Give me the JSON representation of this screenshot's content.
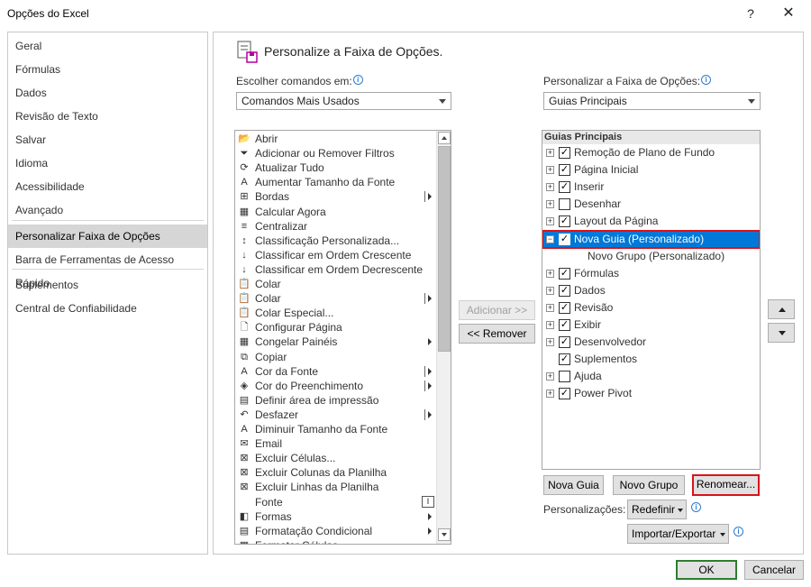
{
  "window": {
    "title": "Opções do Excel",
    "help_glyph": "?",
    "close_glyph": "✕"
  },
  "nav": {
    "items": [
      {
        "label": "Geral"
      },
      {
        "label": "Fórmulas"
      },
      {
        "label": "Dados"
      },
      {
        "label": "Revisão de Texto"
      },
      {
        "label": "Salvar"
      },
      {
        "label": "Idioma"
      },
      {
        "label": "Acessibilidade"
      },
      {
        "label": "Avançado"
      },
      {
        "label": "Personalizar Faixa de Opções",
        "active": true
      },
      {
        "label": "Barra de Ferramentas de Acesso Rápido"
      },
      {
        "label": "Suplementos"
      },
      {
        "label": "Central de Confiabilidade"
      }
    ]
  },
  "main": {
    "heading": "Personalize a Faixa de Opções.",
    "choose_label": "Escolher comandos em:",
    "choose_value": "Comandos Mais Usados",
    "customize_label": "Personalizar a Faixa de Opções:",
    "customize_value": "Guias Principais"
  },
  "commands": [
    {
      "icon": "folder-open-icon",
      "glyph": "📂",
      "label": "Abrir"
    },
    {
      "icon": "filter-icon",
      "glyph": "⏷",
      "label": "Adicionar ou Remover Filtros"
    },
    {
      "icon": "refresh-icon",
      "glyph": "⟳",
      "label": "Atualizar Tudo"
    },
    {
      "icon": "font-grow-icon",
      "glyph": "A",
      "label": "Aumentar Tamanho da Fonte"
    },
    {
      "icon": "borders-icon",
      "glyph": "⊞",
      "label": "Bordas",
      "submenu": "bar"
    },
    {
      "icon": "calculator-icon",
      "glyph": "▦",
      "label": "Calcular Agora"
    },
    {
      "icon": "center-align-icon",
      "glyph": "≡",
      "label": "Centralizar"
    },
    {
      "icon": "custom-sort-icon",
      "glyph": "↕",
      "label": "Classificação Personalizada..."
    },
    {
      "icon": "sort-asc-icon",
      "glyph": "↓",
      "label": "Classificar em Ordem Crescente"
    },
    {
      "icon": "sort-desc-icon",
      "glyph": "↓",
      "label": "Classificar em Ordem Decrescente"
    },
    {
      "icon": "paste-icon",
      "glyph": "📋",
      "label": "Colar"
    },
    {
      "icon": "paste-menu-icon",
      "glyph": "📋",
      "label": "Colar",
      "submenu": "bar"
    },
    {
      "icon": "paste-special-icon",
      "glyph": "📋",
      "label": "Colar Especial..."
    },
    {
      "icon": "page-setup-icon",
      "glyph": "🗋",
      "label": "Configurar Página"
    },
    {
      "icon": "freeze-panes-icon",
      "glyph": "▦",
      "label": "Congelar Painéis",
      "submenu": "arrow"
    },
    {
      "icon": "copy-icon",
      "glyph": "⧉",
      "label": "Copiar"
    },
    {
      "icon": "font-color-icon",
      "glyph": "A",
      "label": "Cor da Fonte",
      "submenu": "bar"
    },
    {
      "icon": "fill-color-icon",
      "glyph": "◈",
      "label": "Cor do Preenchimento",
      "submenu": "bar"
    },
    {
      "icon": "print-area-icon",
      "glyph": "▤",
      "label": "Definir área de impressão"
    },
    {
      "icon": "undo-icon",
      "glyph": "↶",
      "label": "Desfazer",
      "submenu": "bar"
    },
    {
      "icon": "font-shrink-icon",
      "glyph": "A",
      "label": "Diminuir Tamanho da Fonte"
    },
    {
      "icon": "email-icon",
      "glyph": "✉",
      "label": "Email"
    },
    {
      "icon": "delete-cells-icon",
      "glyph": "⊠",
      "label": "Excluir Células..."
    },
    {
      "icon": "delete-columns-icon",
      "glyph": "⊠",
      "label": "Excluir Colunas da Planilha"
    },
    {
      "icon": "delete-rows-icon",
      "glyph": "⊠",
      "label": "Excluir Linhas da Planilha"
    },
    {
      "icon": "font-icon",
      "glyph": "",
      "label": "Fonte",
      "submenu": "fontbox"
    },
    {
      "icon": "shapes-icon",
      "glyph": "◧",
      "label": "Formas",
      "submenu": "arrow"
    },
    {
      "icon": "conditional-format-icon",
      "glyph": "▤",
      "label": "Formatação Condicional",
      "submenu": "arrow"
    },
    {
      "icon": "format-cells-icon",
      "glyph": "▦",
      "label": "Formatar Células..."
    }
  ],
  "font_box_glyph": "I",
  "buttons": {
    "add": "Adicionar >>",
    "remove": "<< Remover",
    "new_tab": "Nova Guia",
    "new_group": "Novo Grupo",
    "rename": "Renomear...",
    "customizations_label": "Personalizações:",
    "reset": "Redefinir",
    "import_export": "Importar/Exportar",
    "ok": "OK",
    "cancel": "Cancelar"
  },
  "tree": {
    "header": "Guias Principais",
    "nodes": [
      {
        "label": "Remoção de Plano de Fundo",
        "checked": true,
        "expand": "⊞"
      },
      {
        "label": "Página Inicial",
        "checked": true,
        "expand": "⊞"
      },
      {
        "label": "Inserir",
        "checked": true,
        "expand": "⊞"
      },
      {
        "label": "Desenhar",
        "checked": false,
        "expand": "⊞"
      },
      {
        "label": "Layout da Página",
        "checked": true,
        "expand": "⊞"
      },
      {
        "label": "Nova Guia (Personalizado)",
        "checked": true,
        "expand": "⊟",
        "selected": true
      },
      {
        "label": "Novo Grupo (Personalizado)",
        "child": true
      },
      {
        "label": "Fórmulas",
        "checked": true,
        "expand": "⊞"
      },
      {
        "label": "Dados",
        "checked": true,
        "expand": "⊞"
      },
      {
        "label": "Revisão",
        "checked": true,
        "expand": "⊞"
      },
      {
        "label": "Exibir",
        "checked": true,
        "expand": "⊞"
      },
      {
        "label": "Desenvolvedor",
        "checked": true,
        "expand": "⊞"
      },
      {
        "label": "Suplementos",
        "checked": true,
        "expand": ""
      },
      {
        "label": "Ajuda",
        "checked": false,
        "expand": "⊞"
      },
      {
        "label": "Power Pivot",
        "checked": true,
        "expand": "⊞"
      }
    ]
  },
  "colors": {
    "accent": "#0078d7",
    "highlight_border": "#d8131c",
    "ok_border": "#2f7d32"
  }
}
